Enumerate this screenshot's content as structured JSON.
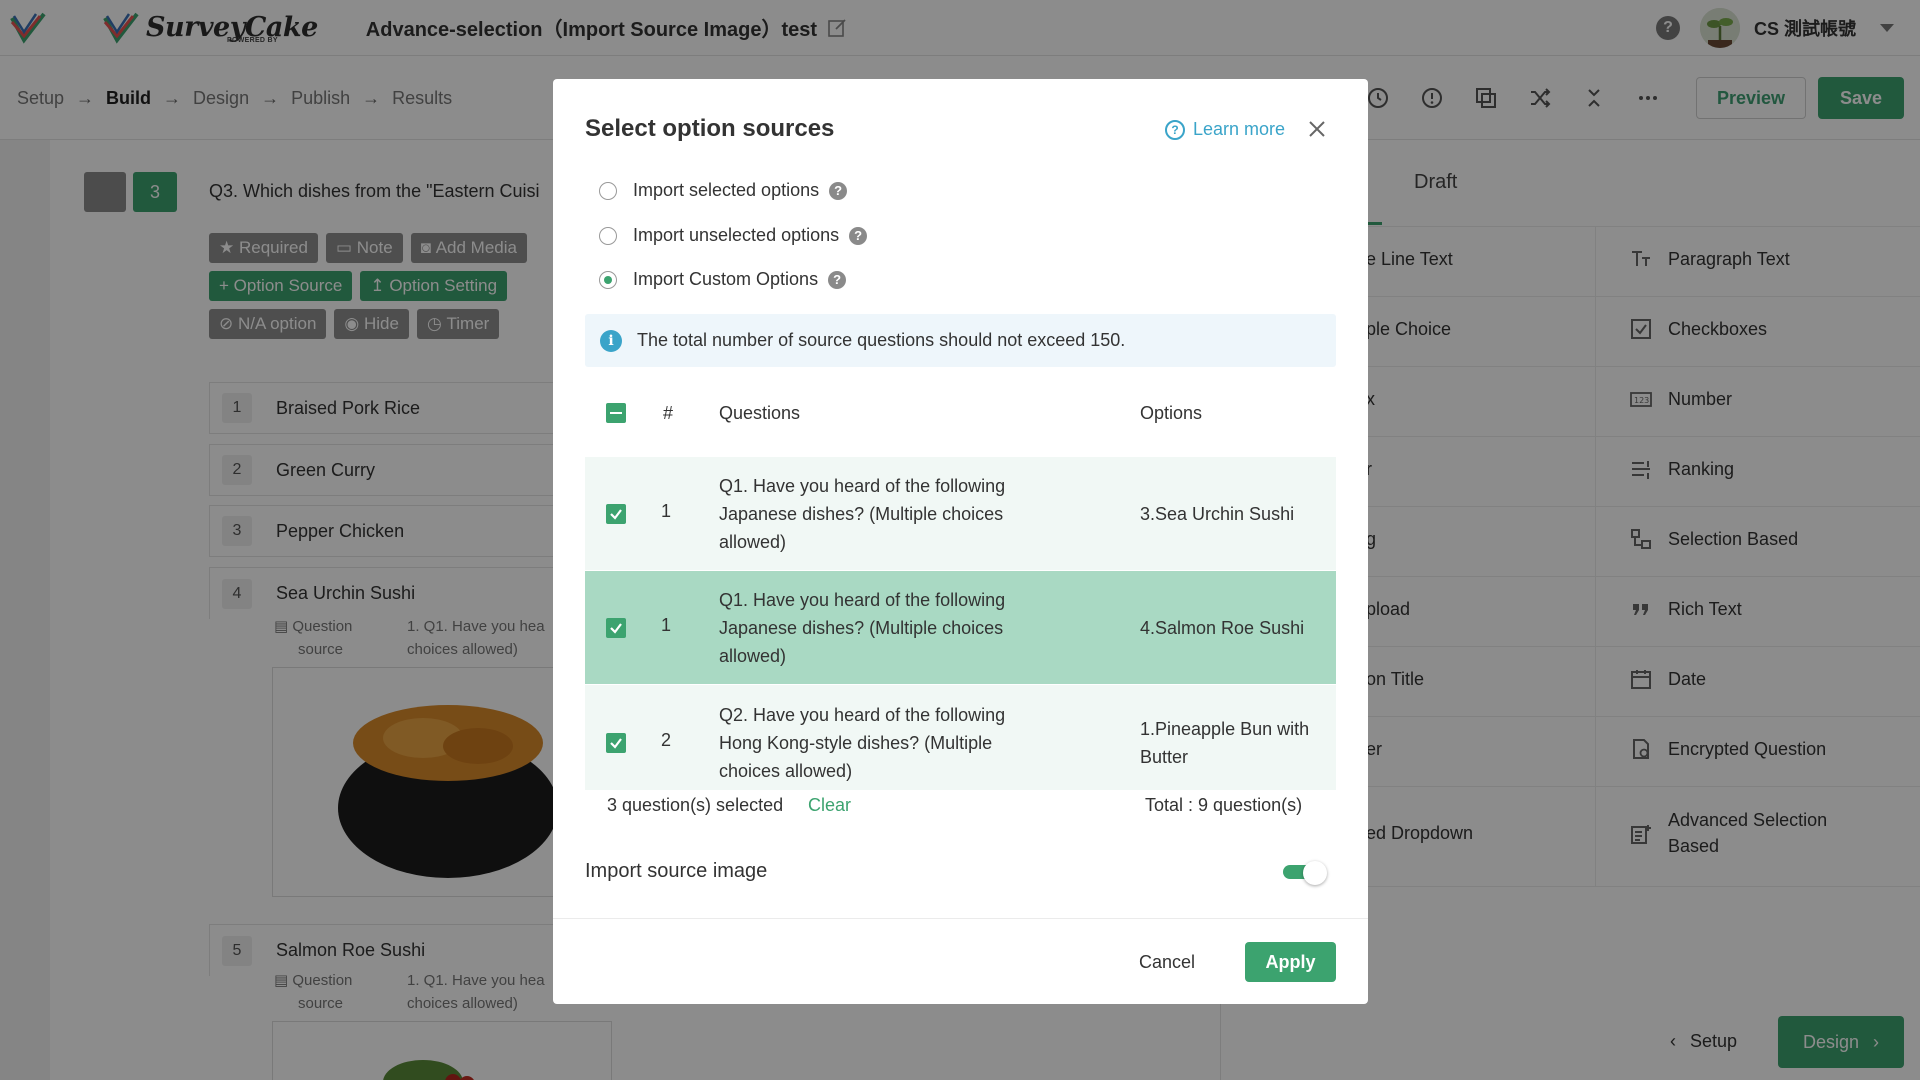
{
  "header": {
    "brand_name": "SurveyCake",
    "brand_sub": "POWERED BY",
    "survey_title": "Advance-selection（Import Source Image）test",
    "account_name": "CS 測試帳號"
  },
  "nav": {
    "steps": [
      "Setup",
      "Build",
      "Design",
      "Publish",
      "Results"
    ],
    "preview_label": "Preview",
    "save_label": "Save"
  },
  "editor": {
    "question_number": "3",
    "question_title": "Q3. Which dishes from the \"Eastern Cuisi",
    "chips_row1": [
      "Required",
      "Note",
      "Add Media"
    ],
    "chips_row2": [
      "Option Source",
      "Option Setting"
    ],
    "chips_row3": [
      "N/A option",
      "Hide",
      "Timer"
    ],
    "options": [
      {
        "num": "1",
        "label": "Braised Pork Rice"
      },
      {
        "num": "2",
        "label": "Green Curry"
      },
      {
        "num": "3",
        "label": "Pepper Chicken"
      },
      {
        "num": "4",
        "label": "Sea Urchin Sushi"
      },
      {
        "num": "5",
        "label": "Salmon Roe Sushi"
      }
    ],
    "source_label_1": "Question",
    "source_label_2": "source",
    "source_detail_1": "1. Q1. Have you hea",
    "source_detail_2": "choices allowed)"
  },
  "right_panel": {
    "tab_label": "Draft",
    "left_col": [
      "e Line Text",
      "ple Choice",
      "x",
      "r",
      "g",
      "pload",
      "on Title",
      "er",
      "ed Dropdown"
    ],
    "right_col": [
      "Paragraph Text",
      "Checkboxes",
      "Number",
      "Ranking",
      "Selection Based",
      "Rich Text",
      "Date",
      "Encrypted Question",
      "Advanced Selection",
      "Based"
    ],
    "setup_label": "Setup",
    "design_label": "Design"
  },
  "modal": {
    "title": "Select option sources",
    "learn_more": "Learn more",
    "radio_options": [
      "Import selected options",
      "Import unselected options",
      "Import Custom Options"
    ],
    "selected_radio": 2,
    "info_text": "The total number of source questions should not exceed 150.",
    "table": {
      "headers": [
        "#",
        "Questions",
        "Options"
      ],
      "rows": [
        {
          "checked": true,
          "num": "1",
          "question": "Q1. Have you heard of the following Japanese dishes? (Multiple choices allowed)",
          "option": "3.Sea Urchin Sushi"
        },
        {
          "checked": true,
          "num": "1",
          "question": "Q1. Have you heard of the following Japanese dishes? (Multiple choices allowed)",
          "option": "4.Salmon Roe Sushi"
        },
        {
          "checked": true,
          "num": "2",
          "question": "Q2. Have you heard of the following Hong Kong-style dishes? (Multiple choices allowed)",
          "option": "1.Pineapple Bun with Butter"
        }
      ]
    },
    "selected_count": "3 question(s) selected",
    "clear_label": "Clear",
    "total_label": "Total : 9 question(s)",
    "import_image_label": "Import source image",
    "import_image_on": true,
    "cancel_label": "Cancel",
    "apply_label": "Apply"
  },
  "colors": {
    "accent": "#3ca36f",
    "highlight_row": "#a9d9c3",
    "info_bg": "#eef6fb",
    "link": "#3aa4c9"
  }
}
